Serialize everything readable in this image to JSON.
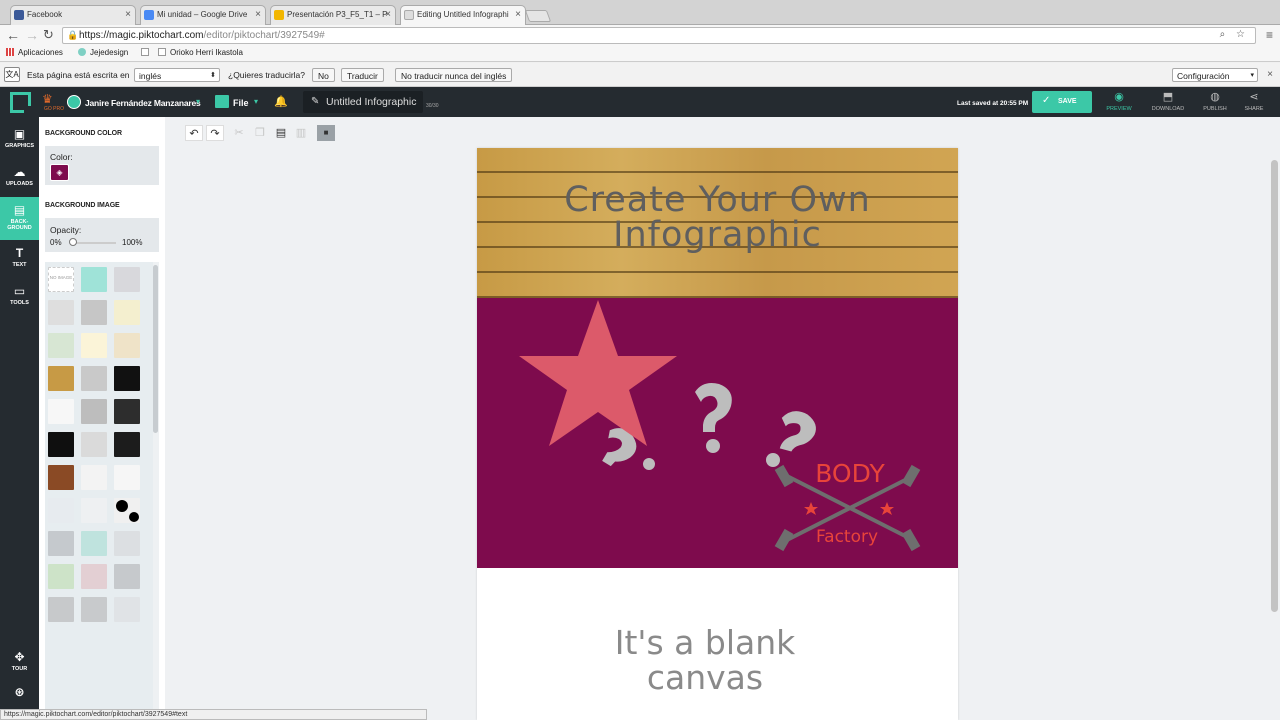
{
  "browser": {
    "tabs": [
      {
        "label": "Facebook",
        "color": "#3b5998"
      },
      {
        "label": "Mi unidad – Google Drive",
        "color": "#4a8af4"
      },
      {
        "label": "Presentación P3_F5_T1 – P",
        "color": "#f2b600"
      },
      {
        "label": "Editing Untitled Infographi",
        "color": "#dddddd"
      }
    ],
    "url_host": "https://magic.piktochart.com",
    "url_path": "/editor/piktochart/3927549#",
    "bookmarks": [
      "Aplicaciones",
      "Jejedesign",
      "",
      "Orioko Herri Ikastola"
    ],
    "translate": {
      "prompt": "Esta página está escrita en",
      "language": "inglés",
      "question": "¿Quieres traducirla?",
      "no": "No",
      "translate": "Traducir",
      "never": "No traducir nunca del inglés",
      "settings": "Configuración"
    },
    "status_url": "https://magic.piktochart.com/editor/piktochart/3927549#text"
  },
  "header": {
    "plan_badge": "GO PRO",
    "user_name": "Janire Fernández Manzanares",
    "file_label": "File",
    "doc_title": "Untitled Infographic",
    "doc_count": "30/30",
    "saved_status": "Last saved at 20:55 PM",
    "save_label": "SAVE",
    "actions": [
      "PREVIEW",
      "DOWNLOAD",
      "PUBLISH",
      "SHARE"
    ],
    "accent": "#3cc8a7"
  },
  "leftnav": {
    "items": [
      "GRAPHICS",
      "UPLOADS",
      "BACK-\nGROUND",
      "TEXT",
      "TOOLS"
    ],
    "bottom": [
      "TOUR",
      ""
    ]
  },
  "panel": {
    "bg_color_heading": "BACKGROUND COLOR",
    "color_label": "Color:",
    "selected_color": "#7e0b4d",
    "bg_image_heading": "BACKGROUND IMAGE",
    "opacity_label": "Opacity:",
    "opacity_min": "0%",
    "opacity_max": "100%",
    "opacity_value": 0,
    "no_image_label": "NO IMAGE"
  },
  "canvas": {
    "title": "Create Your Own Infographic",
    "logo_top": "BODY",
    "logo_bottom": "Factory",
    "blank_text": "It's a blank canvas",
    "block_color": "#7e0b4d",
    "star_color": "#dc5a6a"
  }
}
